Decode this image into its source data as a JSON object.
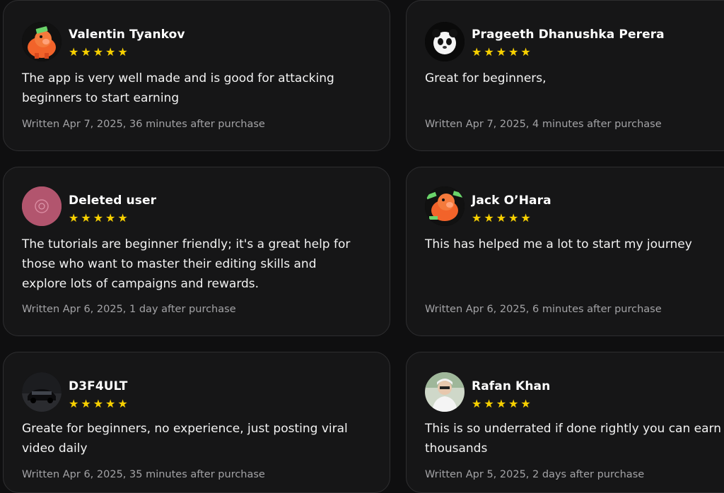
{
  "reviews": [
    {
      "name": "Valentin Tyankov",
      "avatar": "pig-mascot-icon",
      "stars": "★★★★★",
      "rating": 5,
      "text": "The app is very well made and is good for attacking beginners to start earning",
      "date": "Written Apr 7, 2025, 36 minutes after purchase"
    },
    {
      "name": "Prageeth Dhanushka Perera",
      "avatar": "panda-icon",
      "stars": "★★★★★",
      "rating": 5,
      "text": "Great for beginners,",
      "date": "Written Apr 7, 2025, 4 minutes after purchase"
    },
    {
      "name": "Deleted user",
      "avatar": "deleted-user-icon",
      "stars": "★★★★★",
      "rating": 5,
      "text": "The tutorials are beginner friendly; it's a great help for those who want to master their editing skills and explore lots of campaigns and rewards.",
      "date": "Written Apr 6, 2025, 1 day after purchase"
    },
    {
      "name": "Jack O’Hara",
      "avatar": "pig-mascot-icon",
      "stars": "★★★★★",
      "rating": 5,
      "text": "This has helped me a lot to start my journey",
      "date": "Written Apr 6, 2025, 6 minutes after purchase"
    },
    {
      "name": "D3F4ULT",
      "avatar": "car-photo-icon",
      "stars": "★★★★★",
      "rating": 5,
      "text": "Greate for beginners, no experience, just posting viral video daily",
      "date": "Written Apr 6, 2025, 35 minutes after purchase"
    },
    {
      "name": "Rafan Khan",
      "avatar": "person-photo-icon",
      "stars": "★★★★★",
      "rating": 5,
      "text": "This is so underrated if done rightly you can earn thousands",
      "date": "Written Apr 5, 2025, 2 days after purchase"
    }
  ],
  "colors": {
    "background": "#0f0f10",
    "card": "#161617",
    "card_border": "#2e2e30",
    "star": "#f7d000",
    "muted_text": "#a3a3a6"
  }
}
